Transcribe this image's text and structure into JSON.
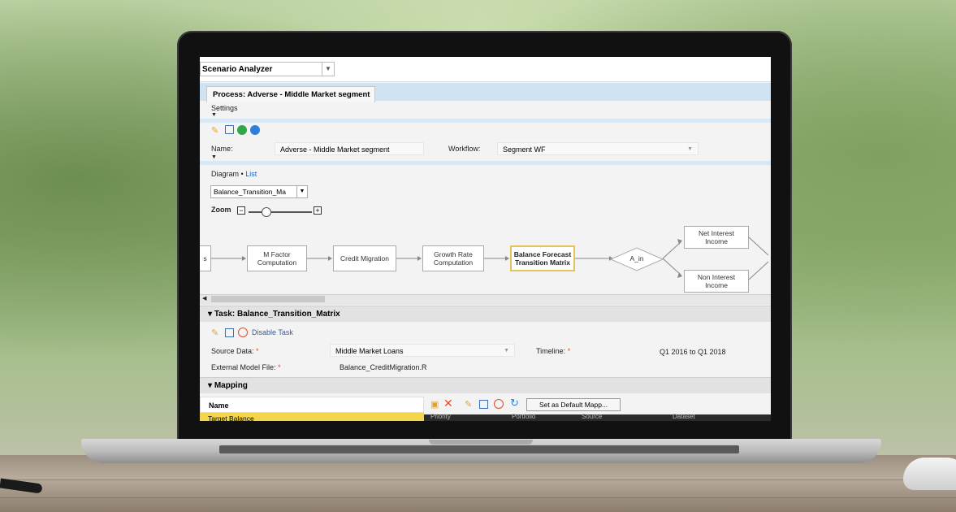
{
  "app": {
    "selector_label": "Scenario Analyzer",
    "process_tab_title": "Process: Adverse - Middle Market segment",
    "settings_label": "Settings"
  },
  "process_form": {
    "name_label": "Name:",
    "name_value": "Adverse - Middle Market segment",
    "workflow_label": "Workflow:",
    "workflow_value": "Segment WF"
  },
  "view": {
    "diagram_label": "Diagram",
    "bullet": "•",
    "list_label": "List",
    "dropdown_value": "Balance_Transition_Ma",
    "zoom_label": "Zoom"
  },
  "diagram": {
    "nodes": [
      {
        "label": "s"
      },
      {
        "label": "M Factor\nComputation"
      },
      {
        "label": "Credit Migration"
      },
      {
        "label": "Growth Rate\nComputation"
      },
      {
        "label": "Balance Forecast\nTransition Matrix"
      },
      {
        "label": "A_in"
      },
      {
        "label": "Net Interest\nIncome"
      },
      {
        "label": "Non Interest\nIncome"
      }
    ]
  },
  "task": {
    "title": "Task: Balance_Transition_Matrix",
    "disable_label": "Disable Task",
    "source_label": "Source Data:",
    "source_value": "Middle Market Loans",
    "timeline_label": "Timeline:",
    "timeline_value": "Q1 2016 to Q1 2018",
    "model_label": "External Model File:",
    "model_value": "Balance_CreditMigration.R",
    "required_mark": "*"
  },
  "mapping": {
    "title": "Mapping",
    "col_name": "Name",
    "row1": "Target Balance",
    "default_button": "Set as Default Mapp...",
    "cols": [
      "Priority",
      "Portfolio",
      "Source",
      "Dataset"
    ]
  },
  "colors": {
    "accent_blue": "#cfe3f3",
    "selected_node": "#e4c35d",
    "required_red": "#e34b2a",
    "row_highlight": "#f2d54b"
  }
}
